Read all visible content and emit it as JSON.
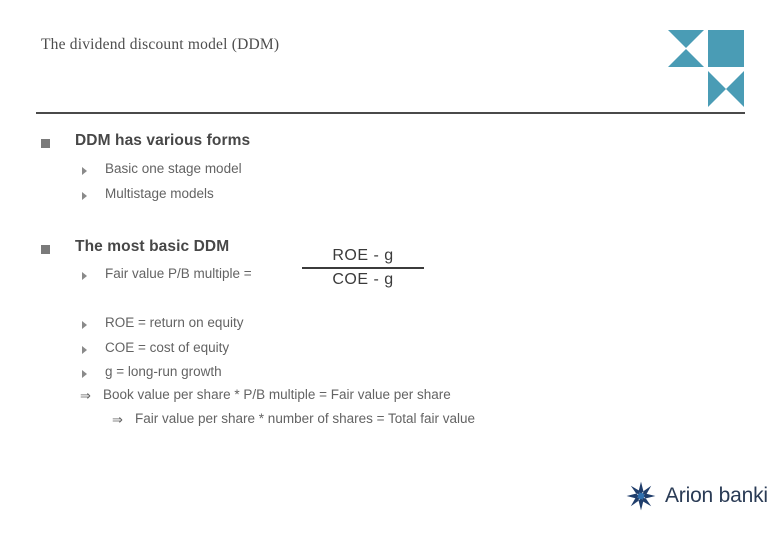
{
  "slide": {
    "title": "The dividend discount model (DDM)",
    "sections": [
      {
        "heading": "DDM has various forms",
        "items": [
          "Basic one stage model",
          "Multistage models"
        ]
      },
      {
        "heading": "The most basic DDM",
        "items": [
          "Fair value P/B multiple ="
        ]
      }
    ],
    "definitions": [
      "ROE = return on equity",
      "COE = cost of equity",
      "g = long-run growth"
    ],
    "conclusions": {
      "arrow_glyph": "⇒",
      "level2": "Book value per share * P/B multiple = Fair value per share",
      "level3": "Fair value per share * number of shares = Total fair value"
    },
    "formula": {
      "numerator": "ROE - g",
      "denominator": "COE - g"
    },
    "brand": {
      "name": "Arion banki",
      "mark": "starburst-icon",
      "mark_color": "#1f3d6b"
    },
    "corner_logo": {
      "name": "geometric-corner-logo",
      "color": "#4a9cb5"
    },
    "colors": {
      "accent_teal": "#4a9cb5",
      "heading_gray": "#474747",
      "body_gray": "#636363",
      "rule_gray": "#4a4a4a",
      "brand_navy": "#2a3b55"
    }
  }
}
